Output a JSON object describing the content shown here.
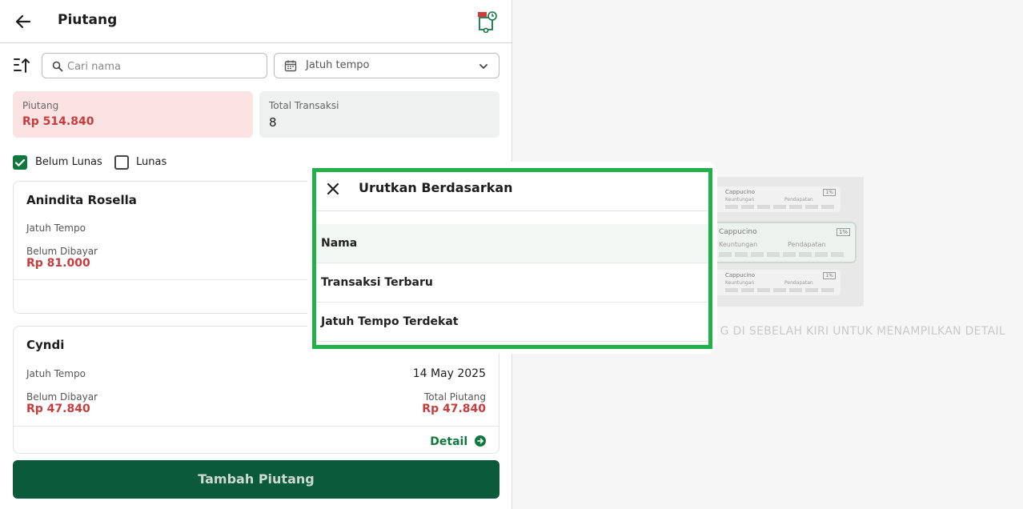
{
  "header": {
    "title": "Piutang",
    "back_icon": "arrow-left-icon",
    "right_icon": "debt-report-icon"
  },
  "toolbar": {
    "search_placeholder": "Cari nama",
    "date_filter_label": "Jatuh tempo"
  },
  "summary": {
    "piutang_label": "Piutang",
    "piutang_value": "Rp 514.840",
    "total_label": "Total Transaksi",
    "total_value": "8"
  },
  "filters": {
    "belum_lunas": {
      "label": "Belum Lunas",
      "checked": true
    },
    "lunas": {
      "label": "Lunas",
      "checked": false
    }
  },
  "cards": [
    {
      "name": "Anindita Rosella",
      "due_label": "Jatuh Tempo",
      "due_value": "",
      "unpaid_label": "Belum Dibayar",
      "unpaid_value": "Rp 81.000",
      "total_label": "",
      "total_value": "",
      "detail_label": ""
    },
    {
      "name": "Cyndi",
      "due_label": "Jatuh Tempo",
      "due_value": "14 May 2025",
      "unpaid_label": "Belum Dibayar",
      "unpaid_value": "Rp 47.840",
      "total_label": "Total Piutang",
      "total_value": "Rp 47.840",
      "detail_label": "Detail"
    }
  ],
  "add_button_label": "Tambah Piutang",
  "empty_state": {
    "message": "G DI SEBELAH KIRI UNTUK MENAMPILKAN DETAIL",
    "illustration": {
      "item_title": "Cappucino",
      "left_label": "Keuntungan",
      "right_label": "Pendapatan",
      "badge": "1%"
    }
  },
  "sort_modal": {
    "title": "Urutkan Berdasarkan",
    "options": [
      "Nama",
      "Transaksi Terbaru",
      "Jatuh Tempo Terdekat"
    ],
    "selected_index": 0
  },
  "colors": {
    "primary": "#0b5a3b",
    "accent_green": "#11773f",
    "danger": "#c83c3c",
    "highlight_border": "#22b04b"
  }
}
